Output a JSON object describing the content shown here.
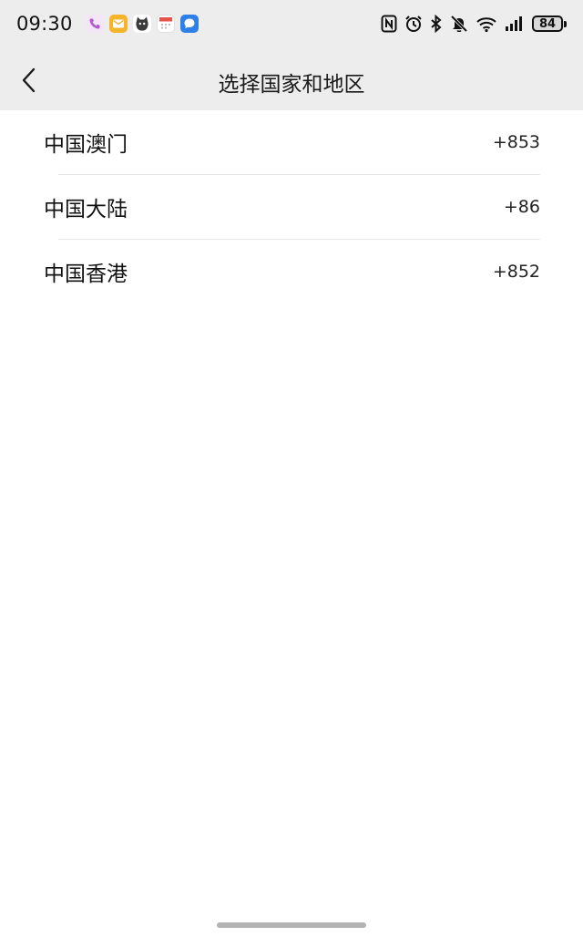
{
  "status_bar": {
    "time": "09:30",
    "battery_level": "84",
    "app_icons": [
      {
        "name": "phone-icon",
        "color": "#c86bd6"
      },
      {
        "name": "mail-icon",
        "color": "#f6a61e"
      },
      {
        "name": "cat-app-icon",
        "color": "#444444"
      },
      {
        "name": "calendar-icon",
        "color": "#e8524a"
      },
      {
        "name": "message-icon",
        "color": "#2f7fe8"
      }
    ],
    "system_icons": [
      "nfc-icon",
      "alarm-icon",
      "bluetooth-icon",
      "mute-icon",
      "wifi-icon",
      "signal-icon"
    ]
  },
  "header": {
    "title": "选择国家和地区"
  },
  "regions": [
    {
      "name": "中国澳门",
      "code": "+853"
    },
    {
      "name": "中国大陆",
      "code": "+86"
    },
    {
      "name": "中国香港",
      "code": "+852"
    }
  ],
  "colors": {
    "header_bg": "#ededed",
    "page_bg": "#ffffff",
    "divider": "#e6e6e6"
  }
}
